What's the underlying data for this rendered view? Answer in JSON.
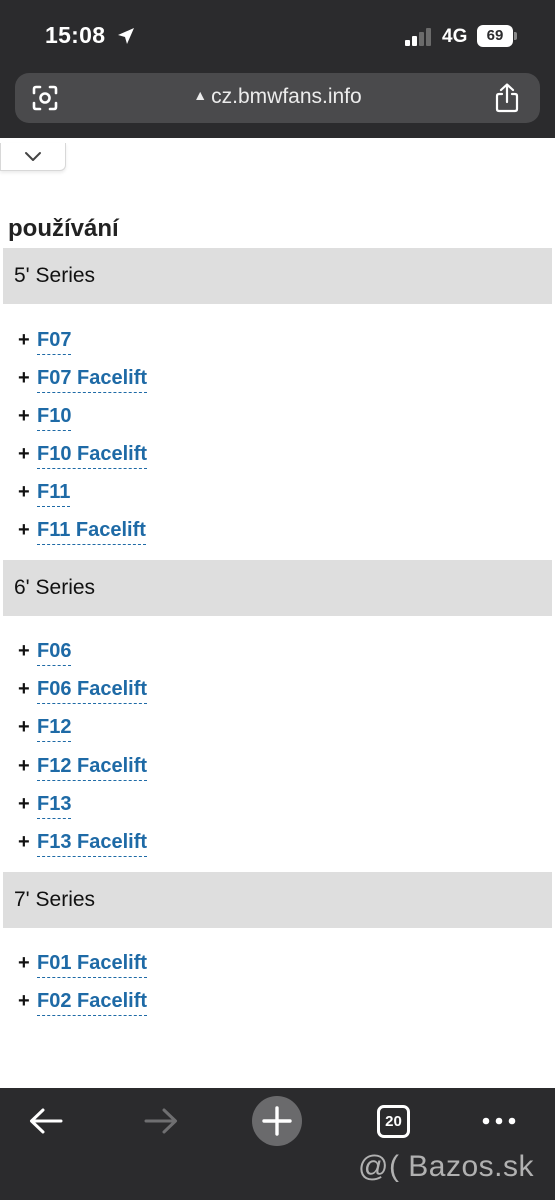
{
  "status_bar": {
    "time": "15:08",
    "network": "4G",
    "battery": "69"
  },
  "browser": {
    "url": "cz.bmwfans.info"
  },
  "page": {
    "heading": "používání",
    "sections": [
      {
        "title": "5' Series",
        "items": [
          "F07",
          "F07 Facelift",
          "F10",
          "F10 Facelift",
          "F11",
          "F11 Facelift"
        ]
      },
      {
        "title": "6' Series",
        "items": [
          "F06",
          "F06 Facelift",
          "F12",
          "F12 Facelift",
          "F13",
          "F13 Facelift"
        ]
      },
      {
        "title": "7' Series",
        "items": [
          "F01 Facelift",
          "F02 Facelift"
        ]
      }
    ],
    "item_prefix": "+"
  },
  "toolbar": {
    "tab_count": "20"
  },
  "watermark": "@( Bazos.sk",
  "colors": {
    "chrome": "#2b2b2d",
    "link": "#1e6aa6",
    "section_bg": "#dedede"
  }
}
